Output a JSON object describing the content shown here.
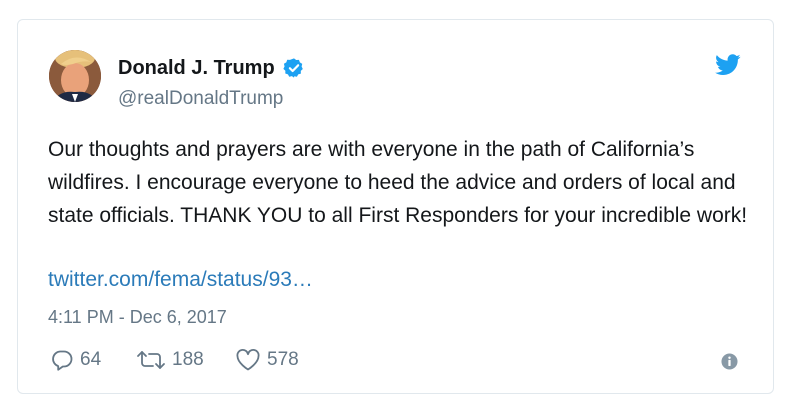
{
  "tweet": {
    "author_name": "Donald J. Trump",
    "handle": "@realDonaldTrump",
    "text": "Our thoughts and prayers are with everyone in the path of California’s wildfires. I encourage everyone to heed the advice and orders of local and state officials. THANK YOU to all First Responders for your incredible work!",
    "link": "twitter.com/fema/status/93…",
    "timestamp": "4:11 PM - Dec 6, 2017",
    "replies": "64",
    "retweets": "188",
    "likes": "578"
  },
  "icons": {
    "verified": "verified-badge-icon",
    "brand": "twitter-bird-icon",
    "reply": "reply-icon",
    "retweet": "retweet-icon",
    "like": "heart-icon",
    "info": "info-icon"
  },
  "colors": {
    "text": "#14171a",
    "secondary": "#657786",
    "link": "#2b7bb9",
    "brand": "#1da1f2",
    "border": "#e1e8ed"
  }
}
